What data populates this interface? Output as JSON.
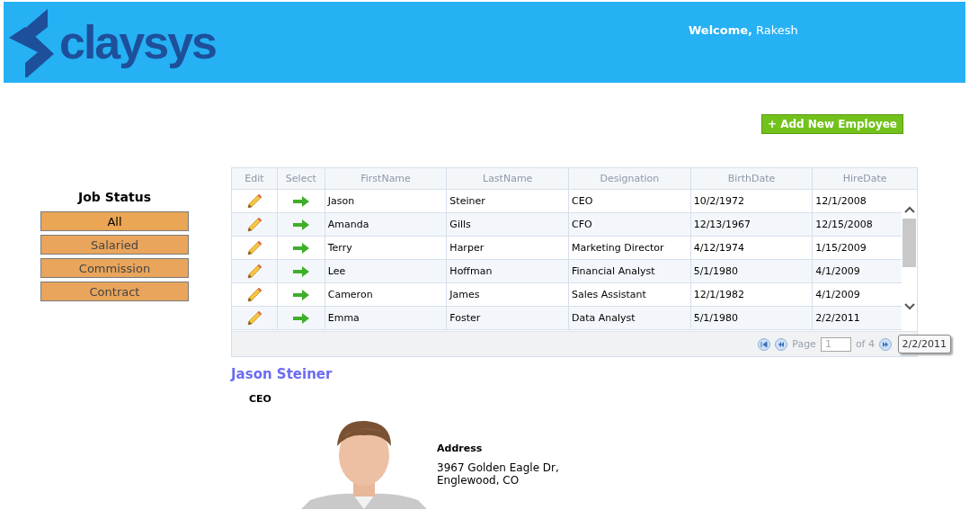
{
  "header": {
    "logo": "claysys",
    "welcome_label": "Welcome,",
    "user": "Rakesh"
  },
  "add_button": "+ Add New Employee",
  "job_status": {
    "title": "Job Status",
    "filters": [
      {
        "label": "All",
        "selected": true
      },
      {
        "label": "Salaried",
        "selected": false
      },
      {
        "label": "Commission",
        "selected": false
      },
      {
        "label": "Contract",
        "selected": false
      }
    ]
  },
  "grid": {
    "columns": [
      "Edit",
      "Select",
      "FirstName",
      "LastName",
      "Designation",
      "BirthDate",
      "HireDate"
    ],
    "rows": [
      {
        "first": "Jason",
        "last": "Steiner",
        "designation": "CEO",
        "birth": "10/2/1972",
        "hire": "12/1/2008"
      },
      {
        "first": "Amanda",
        "last": "Gills",
        "designation": "CFO",
        "birth": "12/13/1967",
        "hire": "12/15/2008"
      },
      {
        "first": "Terry",
        "last": "Harper",
        "designation": "Marketing Director",
        "birth": "4/12/1974",
        "hire": "1/15/2009"
      },
      {
        "first": "Lee",
        "last": "Hoffman",
        "designation": "Financial Analyst",
        "birth": "5/1/1980",
        "hire": "4/1/2009"
      },
      {
        "first": "Cameron",
        "last": "James",
        "designation": "Sales Assistant",
        "birth": "12/1/1982",
        "hire": "4/1/2009"
      },
      {
        "first": "Emma",
        "last": "Foster",
        "designation": "Data Analyst",
        "birth": "5/1/1980",
        "hire": "2/2/2011"
      }
    ],
    "pager": {
      "page_label": "Page",
      "page": "1",
      "of": "of 4"
    },
    "tooltip": "2/2/2011"
  },
  "detail": {
    "name": "Jason Steiner",
    "designation": "CEO",
    "address_label": "Address",
    "address_lines": [
      "3967 Golden Eagle Dr,",
      "Englewood, CO"
    ]
  }
}
